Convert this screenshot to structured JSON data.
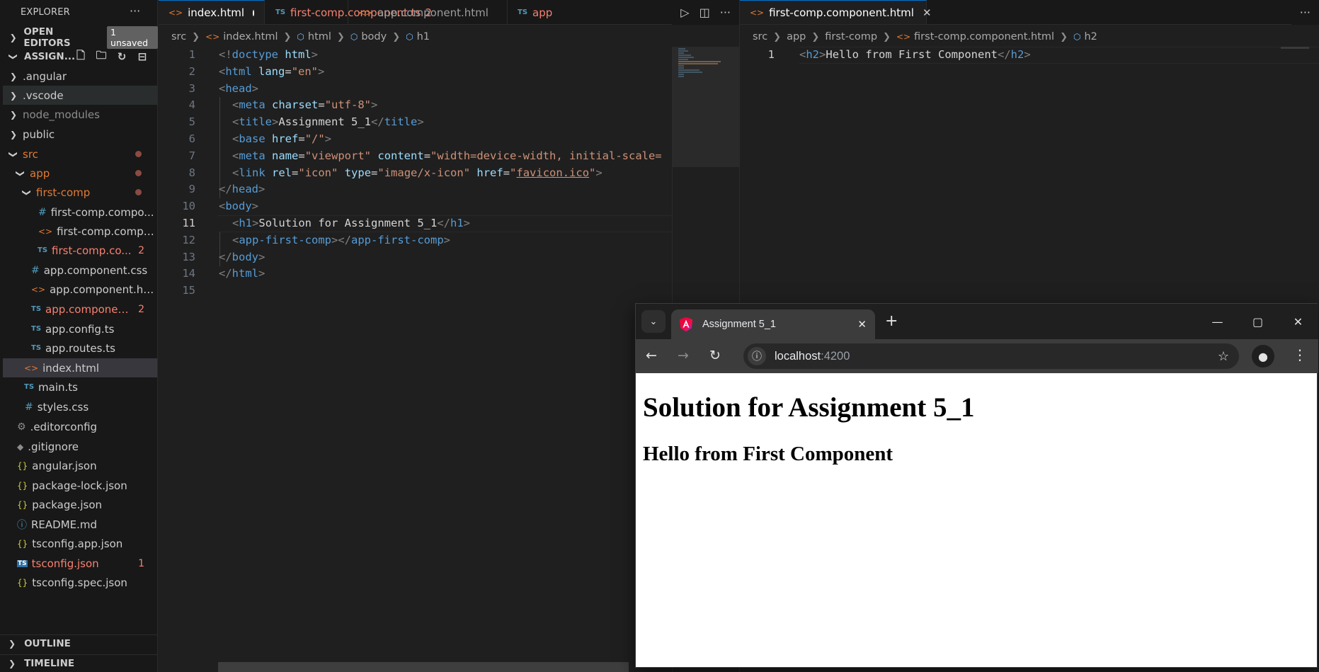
{
  "sidebar": {
    "title": "EXPLORER",
    "open_editors": {
      "label": "OPEN EDITORS",
      "badge": "1 unsaved"
    },
    "project": {
      "label": "ASSIGN..."
    },
    "tree": [
      {
        "label": ".angular",
        "icon": "chevron-right"
      },
      {
        "label": ".vscode",
        "icon": "chevron-right"
      },
      {
        "label": "node_modules",
        "icon": "chevron-right"
      },
      {
        "label": "public",
        "icon": "chevron-right"
      },
      {
        "label": "src",
        "icon": "chevron-down"
      },
      {
        "label": "app",
        "icon": "chevron-down"
      },
      {
        "label": "first-comp",
        "icon": "chevron-down"
      },
      {
        "label": "first-comp.compo...",
        "icon": "css-hash"
      },
      {
        "label": "first-comp.compo...",
        "icon": "html-brackets"
      },
      {
        "label": "first-comp.co...",
        "icon": "ts",
        "badge": "2"
      },
      {
        "label": "app.component.css",
        "icon": "css-hash"
      },
      {
        "label": "app.component.html",
        "icon": "html-brackets"
      },
      {
        "label": "app.componen...",
        "icon": "ts",
        "badge": "2"
      },
      {
        "label": "app.config.ts",
        "icon": "ts"
      },
      {
        "label": "app.routes.ts",
        "icon": "ts"
      },
      {
        "label": "index.html",
        "icon": "html-brackets"
      },
      {
        "label": "main.ts",
        "icon": "ts"
      },
      {
        "label": "styles.css",
        "icon": "css-hash"
      },
      {
        "label": ".editorconfig",
        "icon": "gear"
      },
      {
        "label": ".gitignore",
        "icon": "git-diamond"
      },
      {
        "label": "angular.json",
        "icon": "json-braces"
      },
      {
        "label": "package-lock.json",
        "icon": "json-braces"
      },
      {
        "label": "package.json",
        "icon": "json-braces"
      },
      {
        "label": "README.md",
        "icon": "info"
      },
      {
        "label": "tsconfig.app.json",
        "icon": "json-braces"
      },
      {
        "label": "tsconfig.json",
        "icon": "ts-config",
        "badge": "1"
      },
      {
        "label": "tsconfig.spec.json",
        "icon": "json-braces"
      }
    ],
    "outline": "OUTLINE",
    "timeline": "TIMELINE"
  },
  "editor1": {
    "tabs": [
      {
        "label": "index.html",
        "icon": "html-brackets"
      },
      {
        "label": "first-comp.component.ts",
        "icon": "TS",
        "badge": "2"
      },
      {
        "label": "app.component.html",
        "icon": "html-brackets"
      },
      {
        "label": "app",
        "icon": "TS"
      }
    ],
    "breadcrumb": [
      "src",
      "index.html",
      "html",
      "body",
      "h1"
    ],
    "line_numbers": [
      "1",
      "2",
      "3",
      "4",
      "5",
      "6",
      "7",
      "8",
      "9",
      "10",
      "11",
      "12",
      "13",
      "14",
      "15"
    ],
    "current_line": 11
  },
  "editor2": {
    "tab": {
      "label": "first-comp.component.html",
      "icon": "html-brackets"
    },
    "breadcrumb": [
      "src",
      "app",
      "first-comp",
      "first-comp.component.html",
      "h2"
    ],
    "line_numbers": [
      "1"
    ]
  },
  "code": {
    "l1": {
      "a": "<!",
      "b": "doctype",
      "c": " ",
      "d": "html",
      "e": ">"
    },
    "l2": {
      "a": "<",
      "b": "html",
      "c": " ",
      "d": "lang",
      "e": "=",
      "f": "\"en\"",
      "g": ">"
    },
    "l3": {
      "a": "<",
      "b": "head",
      "c": ">"
    },
    "l4": {
      "a": "<",
      "b": "meta",
      "c": " ",
      "d": "charset",
      "e": "=",
      "f": "\"utf-8\"",
      "g": ">"
    },
    "l5": {
      "a": "<",
      "b": "title",
      "c": ">",
      "d": "Assignment 5_1",
      "e": "</",
      "f": "title",
      "g": ">"
    },
    "l6": {
      "a": "<",
      "b": "base",
      "c": " ",
      "d": "href",
      "e": "=",
      "f": "\"/\"",
      "g": ">"
    },
    "l7": {
      "a": "<",
      "b": "meta",
      "c": " ",
      "d": "name",
      "e": "=",
      "f": "\"viewport\"",
      "g": " ",
      "h": "content",
      "i": "=",
      "j": "\"width=device-width, initial-scale="
    },
    "l8": {
      "a": "<",
      "b": "link",
      "c": " ",
      "d": "rel",
      "e": "=",
      "f": "\"icon\"",
      "g": " ",
      "h": "type",
      "i": "=",
      "j": "\"image/x-icon\"",
      "k": " ",
      "l": "href",
      "m": "=",
      "n": "\"",
      "o": "favicon.ico",
      "p": "\"",
      "q": ">"
    },
    "l9": {
      "a": "</",
      "b": "head",
      "c": ">"
    },
    "l10": {
      "a": "<",
      "b": "body",
      "c": ">"
    },
    "l11": {
      "a": "<",
      "b": "h1",
      "c": ">",
      "d": "Solution for Assignment 5_1",
      "e": "</",
      "f": "h1",
      "g": ">"
    },
    "l12": {
      "a": "<",
      "b": "app-first-comp",
      "c": "></",
      "d": "app-first-comp",
      "e": ">"
    },
    "l13": {
      "a": "</",
      "b": "body",
      "c": ">"
    },
    "l14": {
      "a": "</",
      "b": "html",
      "c": ">"
    },
    "r1": {
      "a": "<",
      "b": "h2",
      "c": ">",
      "d": "Hello from First Component",
      "e": "</",
      "f": "h2",
      "g": ">"
    }
  },
  "browser": {
    "tab_title": "Assignment 5_1",
    "url_host": "localhost",
    "url_port": ":4200",
    "page": {
      "h1": "Solution for Assignment 5_1",
      "h2": "Hello from First Component"
    }
  },
  "colors": {
    "accent": "#0078d4",
    "modified": "#e37933",
    "error": "#f88070",
    "tag": "#569cd6",
    "attribute": "#9cdcfe",
    "string": "#ce9178"
  }
}
